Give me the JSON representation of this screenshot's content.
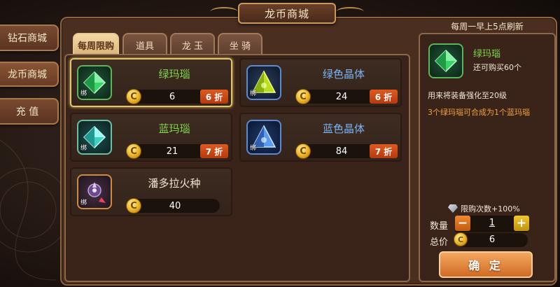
{
  "title": "龙币商城",
  "side_nav": [
    {
      "label": "钻石商城",
      "active": false
    },
    {
      "label": "龙币商城",
      "active": true
    },
    {
      "label": "充 值",
      "active": false
    }
  ],
  "tabs": [
    {
      "label": "每周限购",
      "active": true
    },
    {
      "label": "道具",
      "active": false
    },
    {
      "label": "龙 玉",
      "active": false
    },
    {
      "label": "坐 骑",
      "active": false
    }
  ],
  "bind_tag": "绑",
  "coin_symbol": "C",
  "items": [
    {
      "name": "绿玛瑙",
      "price": "6",
      "discount": "6 折",
      "gem": "green-agate",
      "selected": true
    },
    {
      "name": "绿色晶体",
      "price": "24",
      "discount": "6 折",
      "gem": "green-crystal",
      "selected": false
    },
    {
      "name": "蓝玛瑙",
      "price": "21",
      "discount": "7 折",
      "gem": "blue-agate",
      "selected": false
    },
    {
      "name": "蓝色晶体",
      "price": "84",
      "discount": "7 折",
      "gem": "blue-crystal",
      "selected": false
    },
    {
      "name": "潘多拉火种",
      "price": "40",
      "discount": "",
      "gem": "pandora-tinder",
      "selected": false
    }
  ],
  "detail": {
    "refresh_note": "每周一早上5点刷新",
    "name": "绿玛瑙",
    "remaining": "还可购买60个",
    "desc1": "用来将装备强化至20级",
    "desc2": "3个绿玛瑙可合成为1个蓝玛瑙",
    "limit_label": "限购次数+100%",
    "qty_label": "数量",
    "qty_value": "1",
    "total_label": "总价",
    "total_value": "6",
    "confirm_label": "确 定"
  },
  "colors": {
    "green_name": "#7ed44a",
    "blue_name": "#7ab4f4",
    "discount": "#d04a18",
    "accent_gold": "#e6c46a"
  }
}
